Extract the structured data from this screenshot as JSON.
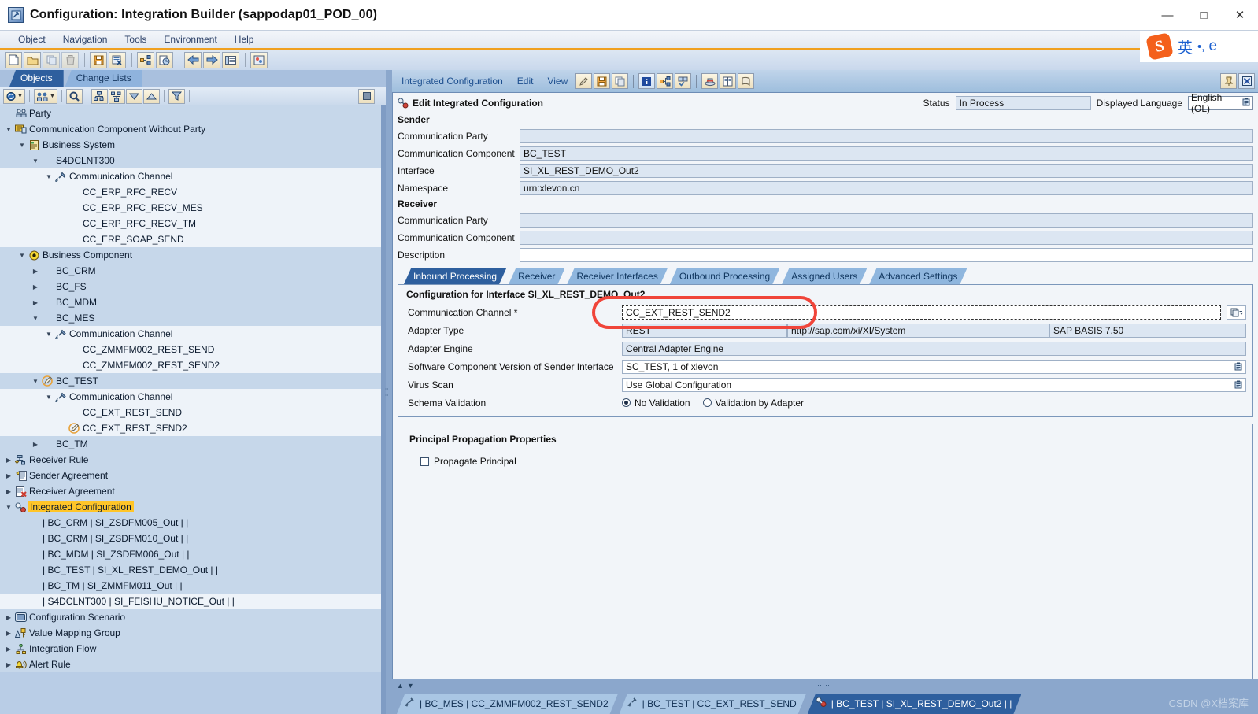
{
  "window": {
    "title": "Configuration: Integration Builder (sappodap01_POD_00)",
    "minimize_label": "—",
    "maximize_label": "□",
    "close_label": "✕"
  },
  "menubar": {
    "items": [
      "Object",
      "Navigation",
      "Tools",
      "Environment",
      "Help"
    ]
  },
  "ime": {
    "logo": "S",
    "mode": "英",
    "punct": "•,",
    "browser": "e"
  },
  "main_toolbar": {
    "buttons": [
      "new-icon",
      "open-icon",
      "copy-icon",
      "delete-icon",
      "save-icon",
      "close-object-icon",
      "where-used-icon",
      "history-icon",
      "back-icon",
      "forward-icon",
      "list-icon",
      "theme-icon"
    ]
  },
  "left_panel": {
    "tabs": [
      {
        "label": "Objects",
        "active": true
      },
      {
        "label": "Change Lists",
        "active": false
      }
    ],
    "toolbar": [
      "refresh-icon",
      "find-pair-icon",
      "search-icon",
      "expand-all-icon",
      "collapse-all-icon",
      "move-down-icon",
      "move-up-icon",
      "filter-icon",
      "stop-icon"
    ],
    "tree": [
      {
        "label": "Party",
        "depth": 0,
        "twist": "",
        "icon": "party-icon",
        "stripe": 1
      },
      {
        "label": "Communication Component Without Party",
        "depth": 0,
        "twist": "down",
        "icon": "comm-component-icon",
        "stripe": 1
      },
      {
        "label": "Business System",
        "depth": 1,
        "twist": "down",
        "icon": "business-system-icon",
        "stripe": 1
      },
      {
        "label": "S4DCLNT300",
        "depth": 2,
        "twist": "down",
        "icon": "",
        "stripe": 1
      },
      {
        "label": "Communication Channel",
        "depth": 3,
        "twist": "down",
        "icon": "channel-icon",
        "stripe": 2
      },
      {
        "label": "CC_ERP_RFC_RECV",
        "depth": 4,
        "twist": "",
        "icon": "",
        "stripe": 2
      },
      {
        "label": "CC_ERP_RFC_RECV_MES",
        "depth": 4,
        "twist": "",
        "icon": "",
        "stripe": 2
      },
      {
        "label": "CC_ERP_RFC_RECV_TM",
        "depth": 4,
        "twist": "",
        "icon": "",
        "stripe": 2
      },
      {
        "label": "CC_ERP_SOAP_SEND",
        "depth": 4,
        "twist": "",
        "icon": "",
        "stripe": 2
      },
      {
        "label": "Business Component",
        "depth": 1,
        "twist": "down",
        "icon": "business-component-icon",
        "stripe": 1
      },
      {
        "label": "BC_CRM",
        "depth": 2,
        "twist": "right",
        "icon": "",
        "stripe": 1
      },
      {
        "label": "BC_FS",
        "depth": 2,
        "twist": "right",
        "icon": "",
        "stripe": 1
      },
      {
        "label": "BC_MDM",
        "depth": 2,
        "twist": "right",
        "icon": "",
        "stripe": 1
      },
      {
        "label": "BC_MES",
        "depth": 2,
        "twist": "down",
        "icon": "",
        "stripe": 1
      },
      {
        "label": "Communication Channel",
        "depth": 3,
        "twist": "down",
        "icon": "channel-icon",
        "stripe": 2
      },
      {
        "label": "CC_ZMMFM002_REST_SEND",
        "depth": 4,
        "twist": "",
        "icon": "",
        "stripe": 2
      },
      {
        "label": "CC_ZMMFM002_REST_SEND2",
        "depth": 4,
        "twist": "",
        "icon": "",
        "stripe": 2
      },
      {
        "label": "BC_TEST",
        "depth": 2,
        "twist": "down",
        "icon": "edit-object-icon",
        "stripe": 1
      },
      {
        "label": "Communication Channel",
        "depth": 3,
        "twist": "down",
        "icon": "channel-icon",
        "stripe": 2
      },
      {
        "label": "CC_EXT_REST_SEND",
        "depth": 4,
        "twist": "",
        "icon": "",
        "stripe": 2
      },
      {
        "label": "CC_EXT_REST_SEND2",
        "depth": 4,
        "twist": "",
        "icon": "edit-object-icon",
        "stripe": 2
      },
      {
        "label": "BC_TM",
        "depth": 2,
        "twist": "right",
        "icon": "",
        "stripe": 1
      },
      {
        "label": "Receiver Rule",
        "depth": 0,
        "twist": "right",
        "icon": "receiver-rule-icon",
        "stripe": 1
      },
      {
        "label": "Sender Agreement",
        "depth": 0,
        "twist": "right",
        "icon": "sender-agreement-icon",
        "stripe": 1
      },
      {
        "label": "Receiver Agreement",
        "depth": 0,
        "twist": "right",
        "icon": "receiver-agreement-icon",
        "stripe": 1
      },
      {
        "label": "Integrated Configuration",
        "depth": 0,
        "twist": "down",
        "icon": "integrated-config-icon",
        "stripe": 1,
        "highlight": true
      },
      {
        "label": "| BC_CRM | SI_ZSDFM005_Out |  |",
        "depth": 1,
        "twist": "",
        "icon": "",
        "stripe": 1
      },
      {
        "label": "| BC_CRM | SI_ZSDFM010_Out |  |",
        "depth": 1,
        "twist": "",
        "icon": "",
        "stripe": 1
      },
      {
        "label": "| BC_MDM | SI_ZSDFM006_Out |  |",
        "depth": 1,
        "twist": "",
        "icon": "",
        "stripe": 1
      },
      {
        "label": "| BC_TEST | SI_XL_REST_DEMO_Out |  |",
        "depth": 1,
        "twist": "",
        "icon": "",
        "stripe": 1
      },
      {
        "label": "| BC_TM | SI_ZMMFM011_Out |  |",
        "depth": 1,
        "twist": "",
        "icon": "",
        "stripe": 1
      },
      {
        "label": "| S4DCLNT300 | SI_FEISHU_NOTICE_Out |  |",
        "depth": 1,
        "twist": "",
        "icon": "",
        "stripe": 2
      },
      {
        "label": "Configuration Scenario",
        "depth": 0,
        "twist": "right",
        "icon": "config-scenario-icon",
        "stripe": 1
      },
      {
        "label": "Value Mapping Group",
        "depth": 0,
        "twist": "right",
        "icon": "value-mapping-icon",
        "stripe": 1
      },
      {
        "label": "Integration Flow",
        "depth": 0,
        "twist": "right",
        "icon": "integration-flow-icon",
        "stripe": 1
      },
      {
        "label": "Alert Rule",
        "depth": 0,
        "twist": "right",
        "icon": "alert-rule-icon",
        "stripe": 1
      }
    ]
  },
  "right_panel": {
    "menus": [
      "Integrated Configuration",
      "Edit",
      "View"
    ],
    "toolbar_icons": [
      "edit-icon",
      "save-icon",
      "copy-icon",
      "info-icon",
      "where-used-icon",
      "check-icon",
      "activate-icon",
      "docs-icon",
      "history-icon"
    ],
    "right_icons": [
      "pin-icon",
      "close-icon"
    ],
    "header": {
      "title": "Edit Integrated Configuration",
      "status_label": "Status",
      "status_value": "In Process",
      "language_label": "Displayed Language",
      "language_value": "English (OL)"
    },
    "sender": {
      "section_title": "Sender",
      "fields": [
        {
          "label": "Communication Party",
          "value": ""
        },
        {
          "label": "Communication Component",
          "value": "BC_TEST"
        },
        {
          "label": "Interface",
          "value": "SI_XL_REST_DEMO_Out2"
        },
        {
          "label": "Namespace",
          "value": "urn:xlevon.cn"
        }
      ]
    },
    "receiver": {
      "section_title": "Receiver",
      "fields": [
        {
          "label": "Communication Party",
          "value": ""
        },
        {
          "label": "Communication Component",
          "value": ""
        },
        {
          "label": "Description",
          "value": "",
          "white": true
        }
      ]
    },
    "tabs": [
      {
        "label": "Inbound Processing",
        "active": true
      },
      {
        "label": "Receiver",
        "active": false
      },
      {
        "label": "Receiver Interfaces",
        "active": false
      },
      {
        "label": "Outbound Processing",
        "active": false
      },
      {
        "label": "Assigned Users",
        "active": false
      },
      {
        "label": "Advanced Settings",
        "active": false
      }
    ],
    "config_box": {
      "title": "Configuration for Interface SI_XL_REST_DEMO_Out2",
      "comm_channel_label": "Communication Channel *",
      "comm_channel_value": "CC_EXT_REST_SEND2",
      "adapter_type_label": "Adapter Type",
      "adapter_type_value": "REST",
      "adapter_namespace": "http://sap.com/xi/XI/System",
      "adapter_swcv": "SAP BASIS 7.50",
      "adapter_engine_label": "Adapter Engine",
      "adapter_engine_value": "Central Adapter Engine",
      "swcv_label": "Software Component Version of Sender Interface",
      "swcv_value": "SC_TEST, 1 of xlevon",
      "virus_scan_label": "Virus Scan",
      "virus_scan_value": "Use Global Configuration",
      "schema_label": "Schema Validation",
      "schema_option_1": "No Validation",
      "schema_option_2": "Validation by Adapter",
      "schema_selected": 1
    },
    "principal_box": {
      "title": "Principal Propagation Properties",
      "checkbox_label": "Propagate Principal",
      "checked": false
    }
  },
  "bottom_tabs": [
    {
      "label": "| BC_MES | CC_ZMMFM002_REST_SEND2",
      "icon": "channel-icon",
      "active": false
    },
    {
      "label": "| BC_TEST | CC_EXT_REST_SEND",
      "icon": "channel-icon",
      "active": false
    },
    {
      "label": "| BC_TEST | SI_XL_REST_DEMO_Out2 |  |",
      "icon": "integrated-config-icon",
      "active": true
    }
  ],
  "watermark": "CSDN @X档案库",
  "colors": {
    "accent_blue": "#2e5f9e",
    "highlight_yellow": "#ffc528",
    "alert_red": "#f0453a",
    "panel_bg": "#f2f5f9",
    "field_bg": "#dce6f2"
  }
}
